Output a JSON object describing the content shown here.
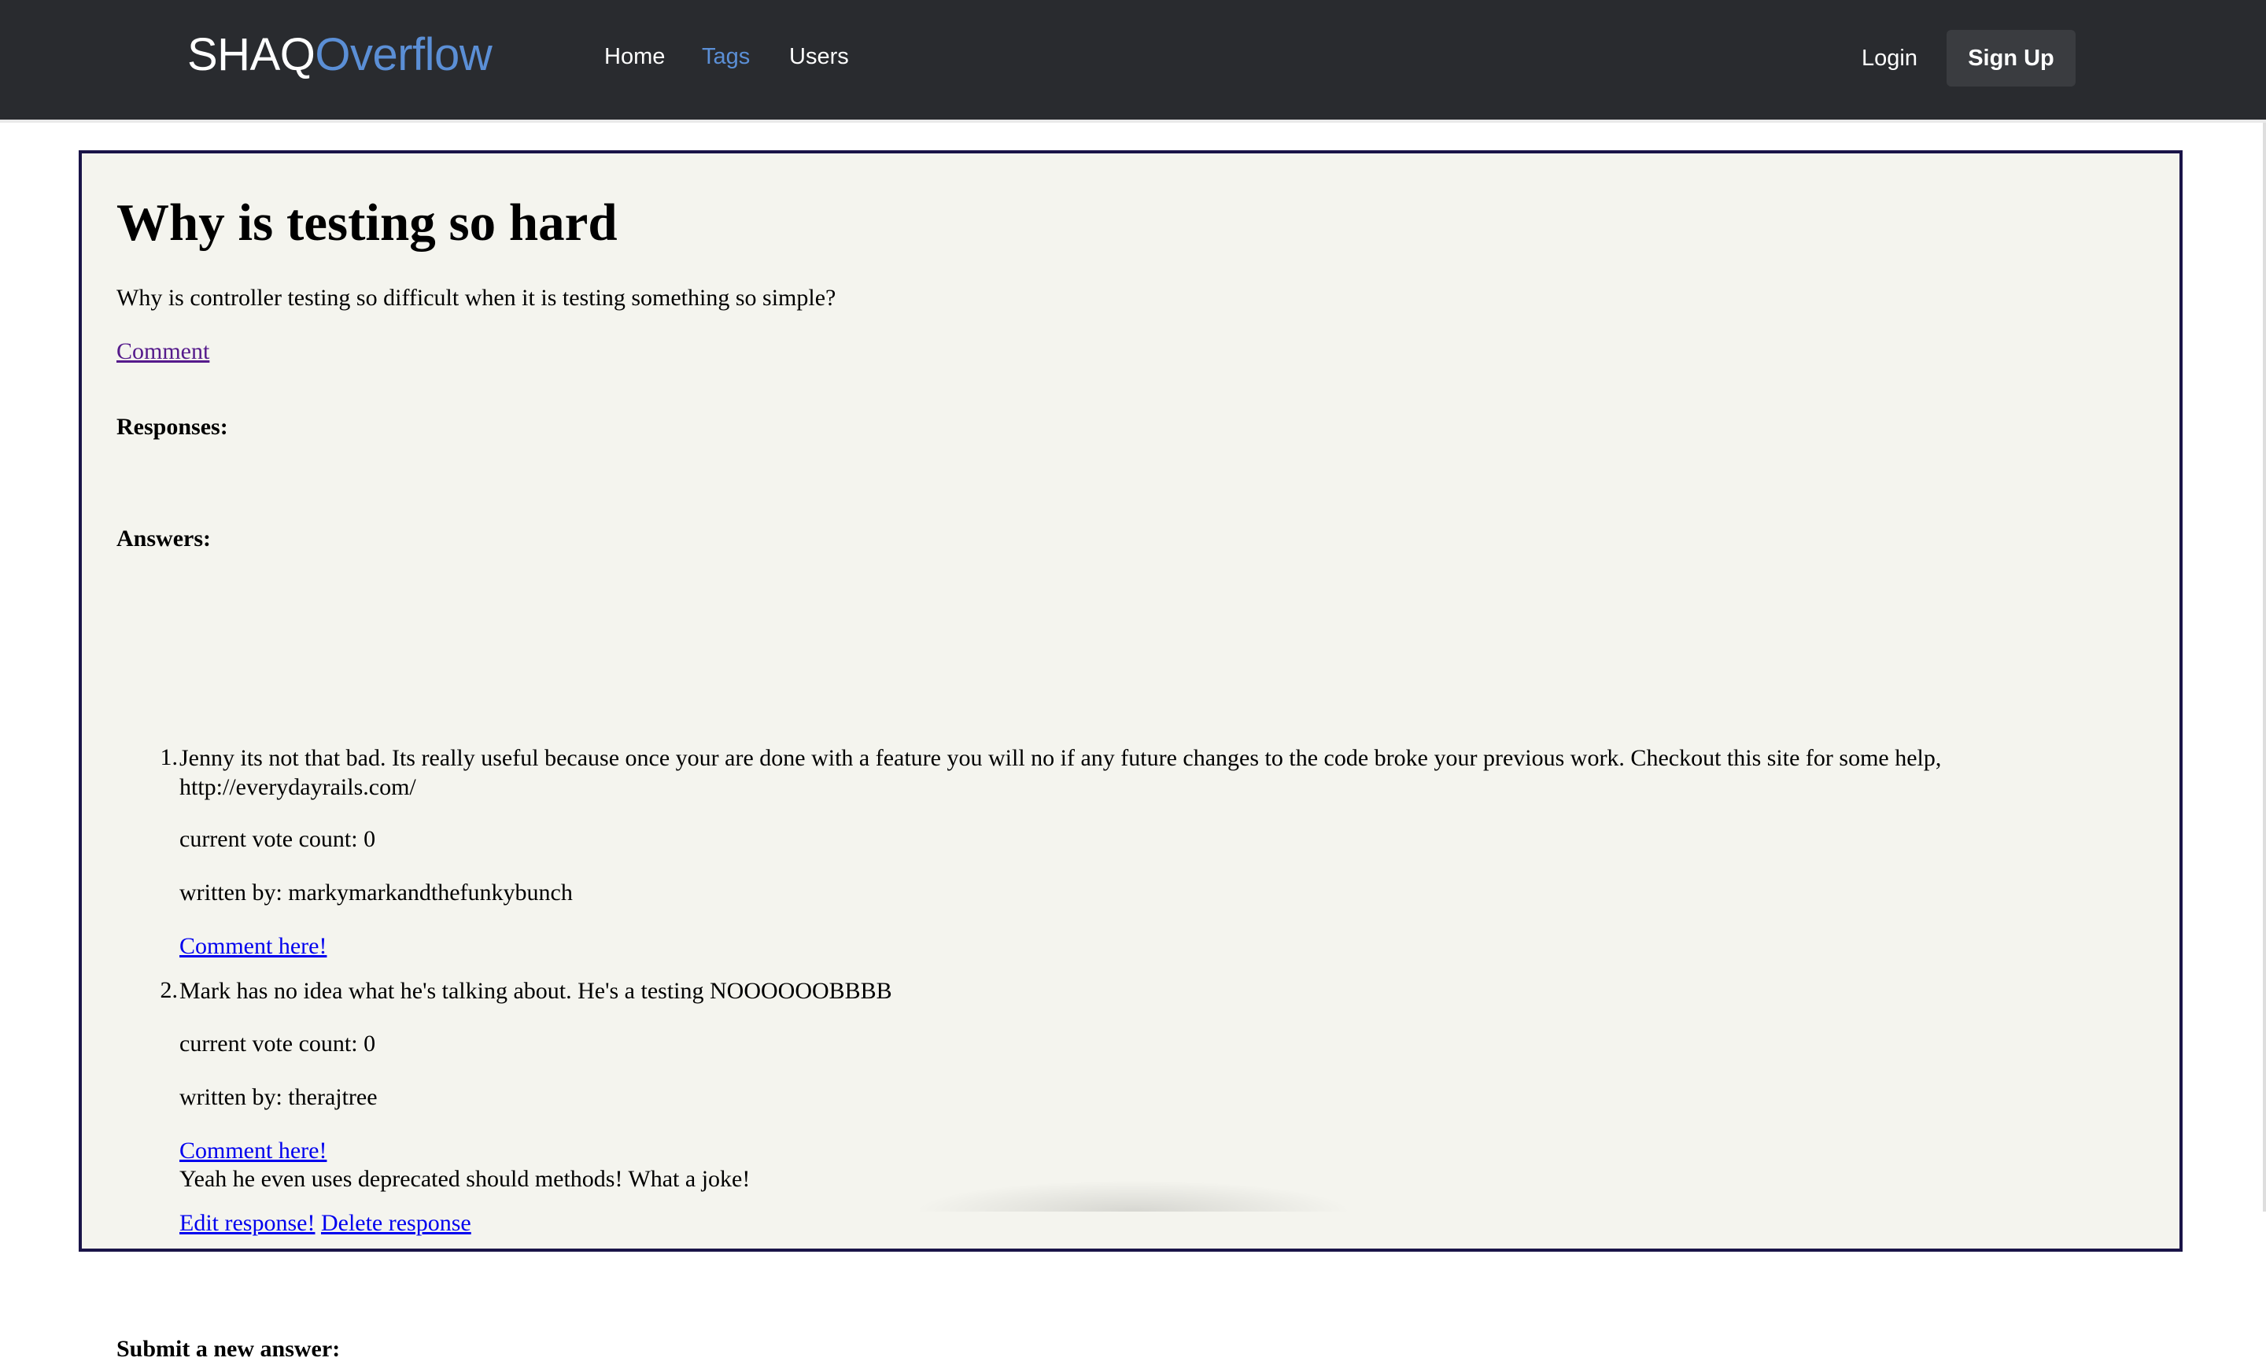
{
  "nav": {
    "brand_main": "SHAQ",
    "brand_accent": "Overflow",
    "links": [
      "Home",
      "Tags",
      "Users"
    ],
    "login": "Login",
    "signup": "Sign Up"
  },
  "question": {
    "title": "Why is testing so hard",
    "body": "Why is controller testing so difficult when it is testing something so simple?",
    "comment_link": "Comment"
  },
  "sections": {
    "responses": "Responses:",
    "answers": "Answers:",
    "submit": "Submit a new answer:"
  },
  "answers": [
    {
      "number": "1.",
      "body_line1": "Jenny its not that bad. Its really useful because once your are done with a feature you will no if any future changes to the code broke your previous work. Checkout this site for some help,",
      "body_line2": "http://everydayrails.com/",
      "votes": "current vote count: 0",
      "author": "written by: markymarkandthefunkybunch",
      "comment_link": "Comment here!"
    },
    {
      "number": "2.",
      "body_line1": "Mark has no idea what he's talking about. He's a testing NOOOOOOBBBB",
      "votes": "current vote count: 0",
      "author": "written by: therajtree",
      "comment_link": "Comment here!",
      "response": "Yeah he even uses deprecated should methods! What a joke!",
      "edit_link": "Edit response!",
      "delete_link": "Delete response"
    }
  ],
  "colors": {
    "navbar_bg": "#292b2f",
    "accent": "#5b8fd6",
    "panel_bg": "#f4f4ee",
    "panel_border": "#1a1448",
    "link": "#0000ee",
    "visited_link": "#551a8b"
  }
}
